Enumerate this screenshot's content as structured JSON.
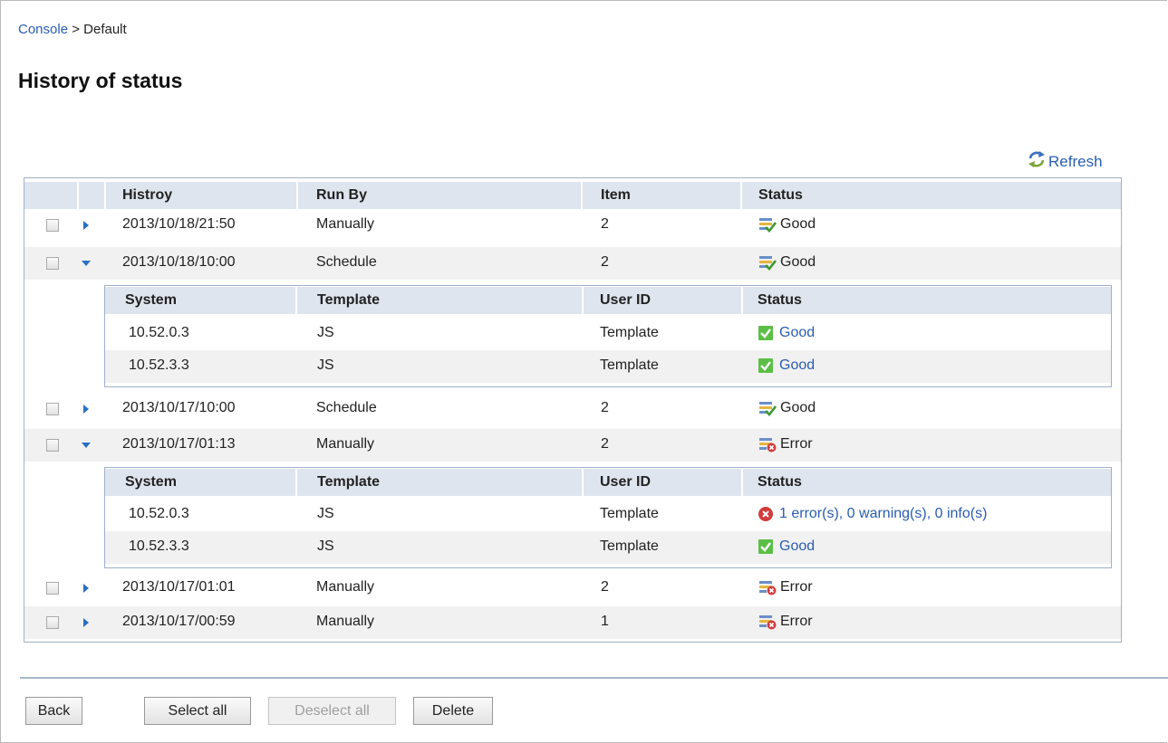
{
  "breadcrumb": {
    "root": "Console",
    "separator": ">",
    "current": "Default"
  },
  "page_title": "History of status",
  "refresh_label": "Refresh",
  "table": {
    "headers": {
      "history": "Histroy",
      "run_by": "Run By",
      "item": "Item",
      "status": "Status"
    },
    "sub_headers": {
      "system": "System",
      "template": "Template",
      "user_id": "User ID",
      "status": "Status"
    },
    "rows": [
      {
        "history": "2013/10/18/21:50",
        "run_by": "Manually",
        "item": "2",
        "status": "Good",
        "expanded": false
      },
      {
        "history": "2013/10/18/10:00",
        "run_by": "Schedule",
        "item": "2",
        "status": "Good",
        "expanded": true,
        "details": [
          {
            "system": "10.52.0.3",
            "template": "JS",
            "user_id": "Template",
            "status": "Good",
            "status_type": "ok"
          },
          {
            "system": "10.52.3.3",
            "template": "JS",
            "user_id": "Template",
            "status": "Good",
            "status_type": "ok"
          }
        ]
      },
      {
        "history": "2013/10/17/10:00",
        "run_by": "Schedule",
        "item": "2",
        "status": "Good",
        "expanded": false
      },
      {
        "history": "2013/10/17/01:13",
        "run_by": "Manually",
        "item": "2",
        "status": "Error",
        "expanded": true,
        "details": [
          {
            "system": "10.52.0.3",
            "template": "JS",
            "user_id": "Template",
            "status": "1 error(s), 0 warning(s), 0 info(s)",
            "status_type": "error"
          },
          {
            "system": "10.52.3.3",
            "template": "JS",
            "user_id": "Template",
            "status": "Good",
            "status_type": "ok"
          }
        ]
      },
      {
        "history": "2013/10/17/01:01",
        "run_by": "Manually",
        "item": "2",
        "status": "Error",
        "expanded": false
      },
      {
        "history": "2013/10/17/00:59",
        "run_by": "Manually",
        "item": "1",
        "status": "Error",
        "expanded": false
      }
    ]
  },
  "buttons": {
    "back": "Back",
    "select_all": "Select all",
    "deselect_all": "Deselect all",
    "delete": "Delete"
  },
  "icons": {
    "refresh": "refresh-icon",
    "good_row": "good-status-icon",
    "error_row": "error-status-icon",
    "good_detail": "green-check-icon",
    "error_detail": "red-x-icon",
    "collapsed": "triangle-right-icon",
    "expanded": "triangle-down-icon"
  },
  "colors": {
    "link": "#2a5db0",
    "header_bg": "#dfe5ee",
    "border": "#9fb0c8",
    "alt_row": "#f1f1f1",
    "error": "#d23c3c",
    "ok": "#4caf50"
  }
}
